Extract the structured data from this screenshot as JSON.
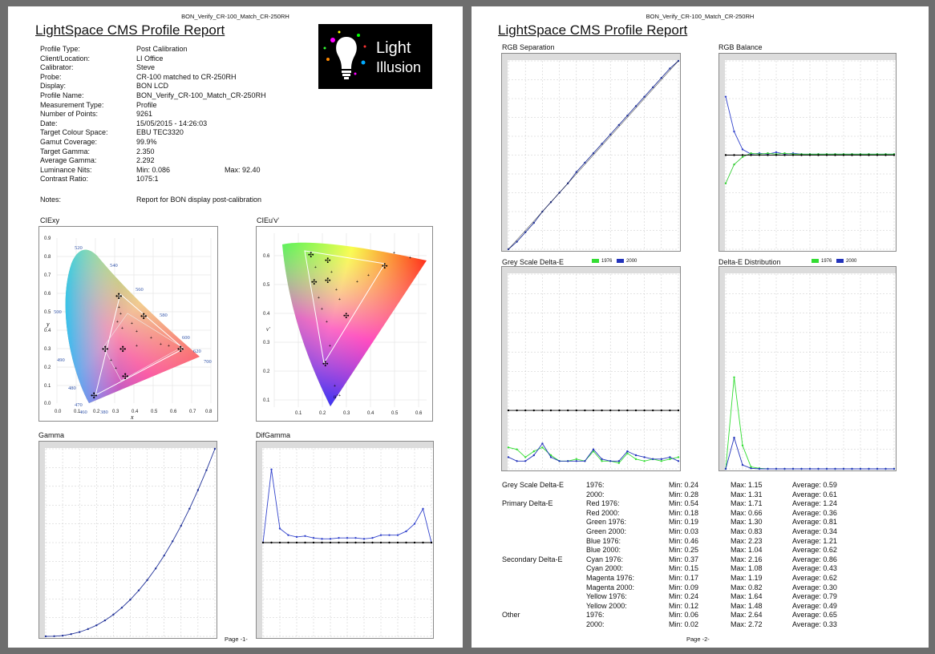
{
  "page1": {
    "filename": "BON_Verify_CR-100_Match_CR-250RH",
    "title": "LightSpace CMS Profile Report",
    "logo": {
      "line1": "Light",
      "line2": "Illusion"
    },
    "info": [
      {
        "key": "Profile Type:",
        "value": "Post Calibration"
      },
      {
        "key": "Client/Location:",
        "value": "LI Office"
      },
      {
        "key": "Calibrator:",
        "value": "Steve"
      },
      {
        "key": "Probe:",
        "value": "CR-100 matched to CR-250RH"
      },
      {
        "key": "Display:",
        "value": "BON LCD"
      },
      {
        "key": "Profile Name:",
        "value": "BON_Verify_CR-100_Match_CR-250RH"
      },
      {
        "key": "Measurement Type:",
        "value": "Profile"
      },
      {
        "key": "Number of Points:",
        "value": "9261"
      },
      {
        "key": "Date:",
        "value": "15/05/2015 - 14:26:03"
      },
      {
        "key": "Target Colour Space:",
        "value": "EBU TEC3320"
      },
      {
        "key": "Gamut Coverage:",
        "value": "99.9%"
      },
      {
        "key": "Target Gamma:",
        "value": "2.350"
      },
      {
        "key": "Average Gamma:",
        "value": "2.292"
      },
      {
        "key": "Luminance Nits:",
        "value": "Min: 0.086",
        "value2": "Max: 92.40"
      },
      {
        "key": "Contrast Ratio:",
        "value": "1075:1"
      }
    ],
    "notes": {
      "key": "Notes:",
      "value": "Report for BON display post-calibration"
    },
    "cie_xy": {
      "label": "CIExy",
      "xlabel": "x",
      "ylabel": "y",
      "xticks": [
        "0.0",
        "0.1",
        "0.2",
        "0.3",
        "0.4",
        "0.5",
        "0.6",
        "0.7",
        "0.8"
      ],
      "yticks": [
        "0.9",
        "0.8",
        "0.7",
        "0.6",
        "0.5",
        "0.4",
        "0.3",
        "0.2",
        "0.1",
        "0.0"
      ],
      "wavelengths": [
        "520",
        "540",
        "560",
        "580",
        "600",
        "620",
        "700",
        "500",
        "490",
        "480",
        "470",
        "460",
        "380"
      ]
    },
    "cie_uv": {
      "label": "CIEu'v'",
      "xlabel": "u'",
      "ylabel": "v'",
      "xticks": [
        "0.1",
        "0.2",
        "0.3",
        "0.4",
        "0.5",
        "0.6"
      ],
      "yticks": [
        "0.6",
        "0.5",
        "0.4",
        "0.3",
        "0.2",
        "0.1"
      ]
    },
    "gamma_label": "Gamma",
    "difgamma_label": "DifGamma",
    "footer": "Page -1-"
  },
  "page2": {
    "filename": "BON_Verify_CR-100_Match_CR-250RH",
    "title": "LightSpace CMS Profile Report",
    "rgb_separation_label": "RGB Separation",
    "rgb_balance_label": "RGB Balance",
    "grey_de_label": "Grey Scale Delta-E",
    "de_dist_label": "Delta-E Distribution",
    "legend": {
      "a": "1976",
      "b": "2000"
    },
    "stats": [
      {
        "group": "Grey Scale Delta-E",
        "item": "1976:",
        "min": "Min: 0.24",
        "max": "Max: 1.15",
        "avg": "Average: 0.59"
      },
      {
        "group": "",
        "item": "2000:",
        "min": "Min: 0.28",
        "max": "Max: 1.31",
        "avg": "Average: 0.61"
      },
      {
        "group": "Primary Delta-E",
        "item": "Red 1976:",
        "min": "Min: 0.54",
        "max": "Max: 1.71",
        "avg": "Average: 1.24"
      },
      {
        "group": "",
        "item": "Red 2000:",
        "min": "Min: 0.18",
        "max": "Max: 0.66",
        "avg": "Average: 0.36"
      },
      {
        "group": "",
        "item": "Green 1976:",
        "min": "Min: 0.19",
        "max": "Max: 1.30",
        "avg": "Average: 0.81"
      },
      {
        "group": "",
        "item": "Green 2000:",
        "min": "Min: 0.03",
        "max": "Max: 0.83",
        "avg": "Average: 0.34"
      },
      {
        "group": "",
        "item": "Blue 1976:",
        "min": "Min: 0.46",
        "max": "Max: 2.23",
        "avg": "Average: 1.21"
      },
      {
        "group": "",
        "item": "Blue 2000:",
        "min": "Min: 0.25",
        "max": "Max: 1.04",
        "avg": "Average: 0.62"
      },
      {
        "group": "Secondary Delta-E",
        "item": "Cyan 1976:",
        "min": "Min: 0.37",
        "max": "Max: 2.16",
        "avg": "Average: 0.86"
      },
      {
        "group": "",
        "item": "Cyan 2000:",
        "min": "Min: 0.15",
        "max": "Max: 1.08",
        "avg": "Average: 0.43"
      },
      {
        "group": "",
        "item": "Magenta 1976:",
        "min": "Min: 0.17",
        "max": "Max: 1.19",
        "avg": "Average: 0.62"
      },
      {
        "group": "",
        "item": "Magenta 2000:",
        "min": "Min: 0.09",
        "max": "Max: 0.82",
        "avg": "Average: 0.30"
      },
      {
        "group": "",
        "item": "Yellow 1976:",
        "min": "Min: 0.24",
        "max": "Max: 1.64",
        "avg": "Average: 0.79"
      },
      {
        "group": "",
        "item": "Yellow 2000:",
        "min": "Min: 0.12",
        "max": "Max: 1.48",
        "avg": "Average: 0.49"
      },
      {
        "group": "Other",
        "item": "1976:",
        "min": "Min: 0.06",
        "max": "Max: 2.64",
        "avg": "Average: 0.65"
      },
      {
        "group": "",
        "item": "2000:",
        "min": "Min: 0.02",
        "max": "Max: 2.72",
        "avg": "Average: 0.33"
      }
    ],
    "footer": "Page -2-"
  },
  "colors": {
    "s1976": "#33dd33",
    "s2000": "#2233bb",
    "ref": "#000000"
  },
  "chart_data": [
    {
      "type": "line",
      "title": "Gamma",
      "x": [
        0,
        0.05,
        0.1,
        0.15,
        0.2,
        0.25,
        0.3,
        0.35,
        0.4,
        0.45,
        0.5,
        0.55,
        0.6,
        0.65,
        0.7,
        0.75,
        0.8,
        0.85,
        0.9,
        0.95,
        1.0
      ],
      "series": [
        {
          "values": [
            0,
            0.001,
            0.004,
            0.012,
            0.023,
            0.039,
            0.059,
            0.085,
            0.116,
            0.153,
            0.196,
            0.245,
            0.3,
            0.362,
            0.431,
            0.507,
            0.59,
            0.681,
            0.78,
            0.886,
            1.0
          ]
        }
      ],
      "xlim": [
        0,
        1
      ],
      "ylim": [
        0,
        1
      ]
    },
    {
      "type": "line",
      "title": "DifGamma",
      "x": [
        0,
        0.05,
        0.1,
        0.15,
        0.2,
        0.25,
        0.3,
        0.35,
        0.4,
        0.45,
        0.5,
        0.55,
        0.6,
        0.65,
        0.7,
        0.75,
        0.8,
        0.85,
        0.9,
        0.95,
        1.0
      ],
      "series": [
        {
          "values": [
            0,
            0.78,
            0.15,
            0.08,
            0.06,
            0.07,
            0.05,
            0.04,
            0.04,
            0.05,
            0.05,
            0.05,
            0.04,
            0.05,
            0.08,
            0.08,
            0.08,
            0.12,
            0.2,
            0.36,
            0
          ]
        },
        {
          "values": [
            0,
            0,
            0,
            0,
            0,
            0,
            0,
            0,
            0,
            0,
            0,
            0,
            0,
            0,
            0,
            0,
            0,
            0,
            0,
            0,
            0
          ]
        }
      ],
      "xlim": [
        0,
        1
      ],
      "ylim": [
        -1,
        1
      ]
    },
    {
      "type": "line",
      "title": "RGB Separation",
      "x": [
        0,
        0.05,
        0.1,
        0.15,
        0.2,
        0.25,
        0.3,
        0.35,
        0.4,
        0.45,
        0.5,
        0.55,
        0.6,
        0.65,
        0.7,
        0.75,
        0.8,
        0.85,
        0.9,
        0.95,
        1.0
      ],
      "series": [
        {
          "values": [
            0,
            0.04,
            0.09,
            0.14,
            0.2,
            0.25,
            0.3,
            0.35,
            0.41,
            0.46,
            0.51,
            0.56,
            0.61,
            0.66,
            0.71,
            0.76,
            0.81,
            0.86,
            0.91,
            0.96,
            1.0
          ]
        }
      ],
      "xlim": [
        0,
        1
      ],
      "ylim": [
        0,
        1
      ]
    },
    {
      "type": "line",
      "title": "RGB Balance",
      "x": [
        0,
        0.05,
        0.1,
        0.15,
        0.2,
        0.25,
        0.3,
        0.35,
        0.4,
        0.45,
        0.5,
        0.55,
        0.6,
        0.65,
        0.7,
        0.75,
        0.8,
        0.85,
        0.9,
        0.95,
        1.0
      ],
      "series": [
        {
          "values": [
            0.62,
            0.25,
            0.06,
            0.01,
            0.02,
            0.01,
            0.03,
            0.01,
            0.02,
            0.01,
            0.01,
            0.01,
            0.01,
            0.01,
            0.01,
            0.01,
            0.01,
            0.01,
            0.01,
            0.01,
            0.01
          ]
        },
        {
          "values": [
            -0.3,
            -0.1,
            -0.02,
            0.02,
            0.01,
            0.02,
            0.01,
            0.02,
            0.01,
            0.01,
            0.01,
            0.01,
            0.01,
            0.01,
            0.01,
            0.01,
            0.01,
            0.01,
            0.01,
            0.01,
            0.01
          ]
        }
      ],
      "xlim": [
        0,
        1
      ],
      "ylim": [
        -1,
        1
      ]
    },
    {
      "type": "line",
      "title": "Grey Scale Delta-E",
      "x": [
        0,
        0.05,
        0.1,
        0.15,
        0.2,
        0.25,
        0.3,
        0.35,
        0.4,
        0.45,
        0.5,
        0.55,
        0.6,
        0.65,
        0.7,
        0.75,
        0.8,
        0.85,
        0.9,
        0.95,
        1.0
      ],
      "series": [
        {
          "name": "1976",
          "values": [
            1.1,
            1.0,
            0.6,
            0.9,
            1.1,
            0.7,
            0.4,
            0.4,
            0.5,
            0.4,
            0.9,
            0.4,
            0.4,
            0.3,
            0.8,
            0.5,
            0.4,
            0.5,
            0.4,
            0.5,
            0.6
          ]
        },
        {
          "name": "2000",
          "values": [
            0.6,
            0.4,
            0.4,
            0.7,
            1.3,
            0.6,
            0.4,
            0.4,
            0.4,
            0.4,
            1.0,
            0.5,
            0.4,
            0.4,
            0.9,
            0.7,
            0.6,
            0.5,
            0.5,
            0.6,
            0.4
          ]
        }
      ],
      "ylim": [
        0,
        10
      ]
    },
    {
      "type": "line",
      "title": "Delta-E Distribution",
      "x": [
        0,
        0.5,
        1,
        1.5,
        2,
        2.5,
        3,
        3.5,
        4,
        4.5,
        5,
        5.5,
        6,
        6.5,
        7,
        7.5,
        8,
        8.5,
        9,
        9.5,
        10
      ],
      "series": [
        {
          "name": "1976",
          "values": [
            0,
            47,
            12,
            1,
            0.3,
            0,
            0,
            0,
            0,
            0,
            0,
            0,
            0,
            0,
            0,
            0,
            0,
            0,
            0,
            0,
            0
          ]
        },
        {
          "name": "2000",
          "values": [
            0,
            16,
            2,
            0.3,
            0,
            0,
            0,
            0,
            0,
            0,
            0,
            0,
            0,
            0,
            0,
            0,
            0,
            0,
            0,
            0,
            0
          ]
        }
      ],
      "ylim": [
        0,
        100
      ]
    }
  ]
}
